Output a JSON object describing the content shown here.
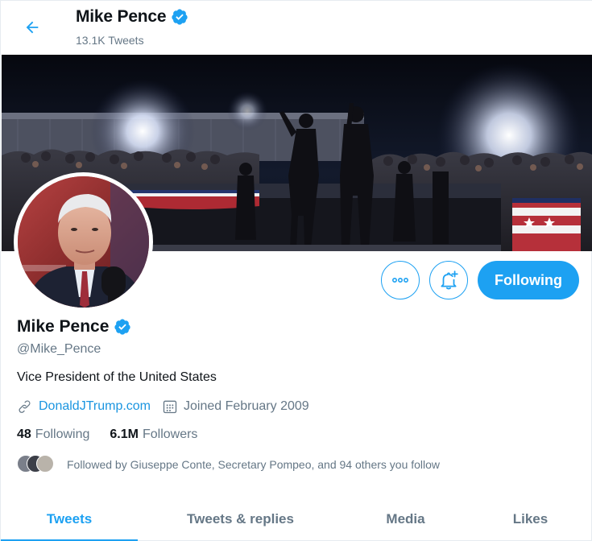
{
  "header": {
    "name": "Mike Pence",
    "tweet_count": "13.1K Tweets"
  },
  "profile": {
    "name": "Mike Pence",
    "handle": "@Mike_Pence",
    "bio": "Vice President of the United States",
    "website": "DonaldJTrump.com",
    "joined": "Joined February 2009",
    "following_count": "48",
    "following_label": "Following",
    "followers_count": "6.1M",
    "followers_label": "Followers",
    "followed_by": "Followed by Giuseppe Conte, Secretary Pompeo, and 94 others you follow"
  },
  "actions": {
    "following_label": "Following"
  },
  "tabs": [
    {
      "label": "Tweets",
      "active": true
    },
    {
      "label": "Tweets & replies",
      "active": false
    },
    {
      "label": "Media",
      "active": false
    },
    {
      "label": "Likes",
      "active": false
    }
  ],
  "colors": {
    "accent": "#1da1f2",
    "link": "#1b95e0",
    "secondary_text": "#657786",
    "primary_text": "#0f1419"
  },
  "icons": [
    "back-arrow-icon",
    "verified-badge-icon",
    "more-options-icon",
    "notification-bell-icon",
    "link-icon",
    "calendar-icon"
  ]
}
